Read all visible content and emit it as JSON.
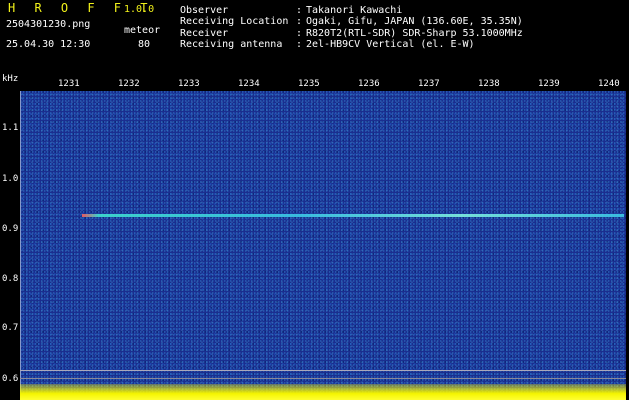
{
  "app": {
    "title": "H R O F F T",
    "version": "1.0.0"
  },
  "recording": {
    "filename": "2504301230.png",
    "datetime": "25.04.30 12:30",
    "mode_label": "meteor",
    "mode_value": "80"
  },
  "info": [
    {
      "label": "Observer",
      "value": "Takanori Kawachi"
    },
    {
      "label": "Receiving Location",
      "value": "Ogaki, Gifu, JAPAN (136.60E, 35.35N)"
    },
    {
      "label": "Receiver",
      "value": "R820T2(RTL-SDR) SDR-Sharp 53.1000MHz"
    },
    {
      "label": "Receiving antenna",
      "value": "2el-HB9CV Vertical (el. E-W)"
    }
  ],
  "axis": {
    "unit": "kHz",
    "y_ticks": [
      "1.1",
      "1.0",
      "0.9",
      "0.8",
      "0.7",
      "0.6"
    ],
    "x_ticks": [
      "1231",
      "1232",
      "1233",
      "1234",
      "1235",
      "1236",
      "1237",
      "1238",
      "1239",
      "1240"
    ]
  },
  "colors": {
    "header_yellow": "#f2f21a",
    "spectrogram_bg": "#1a2e8f",
    "trace": "#3cc8e6",
    "level_bar": "#f5f500"
  }
}
